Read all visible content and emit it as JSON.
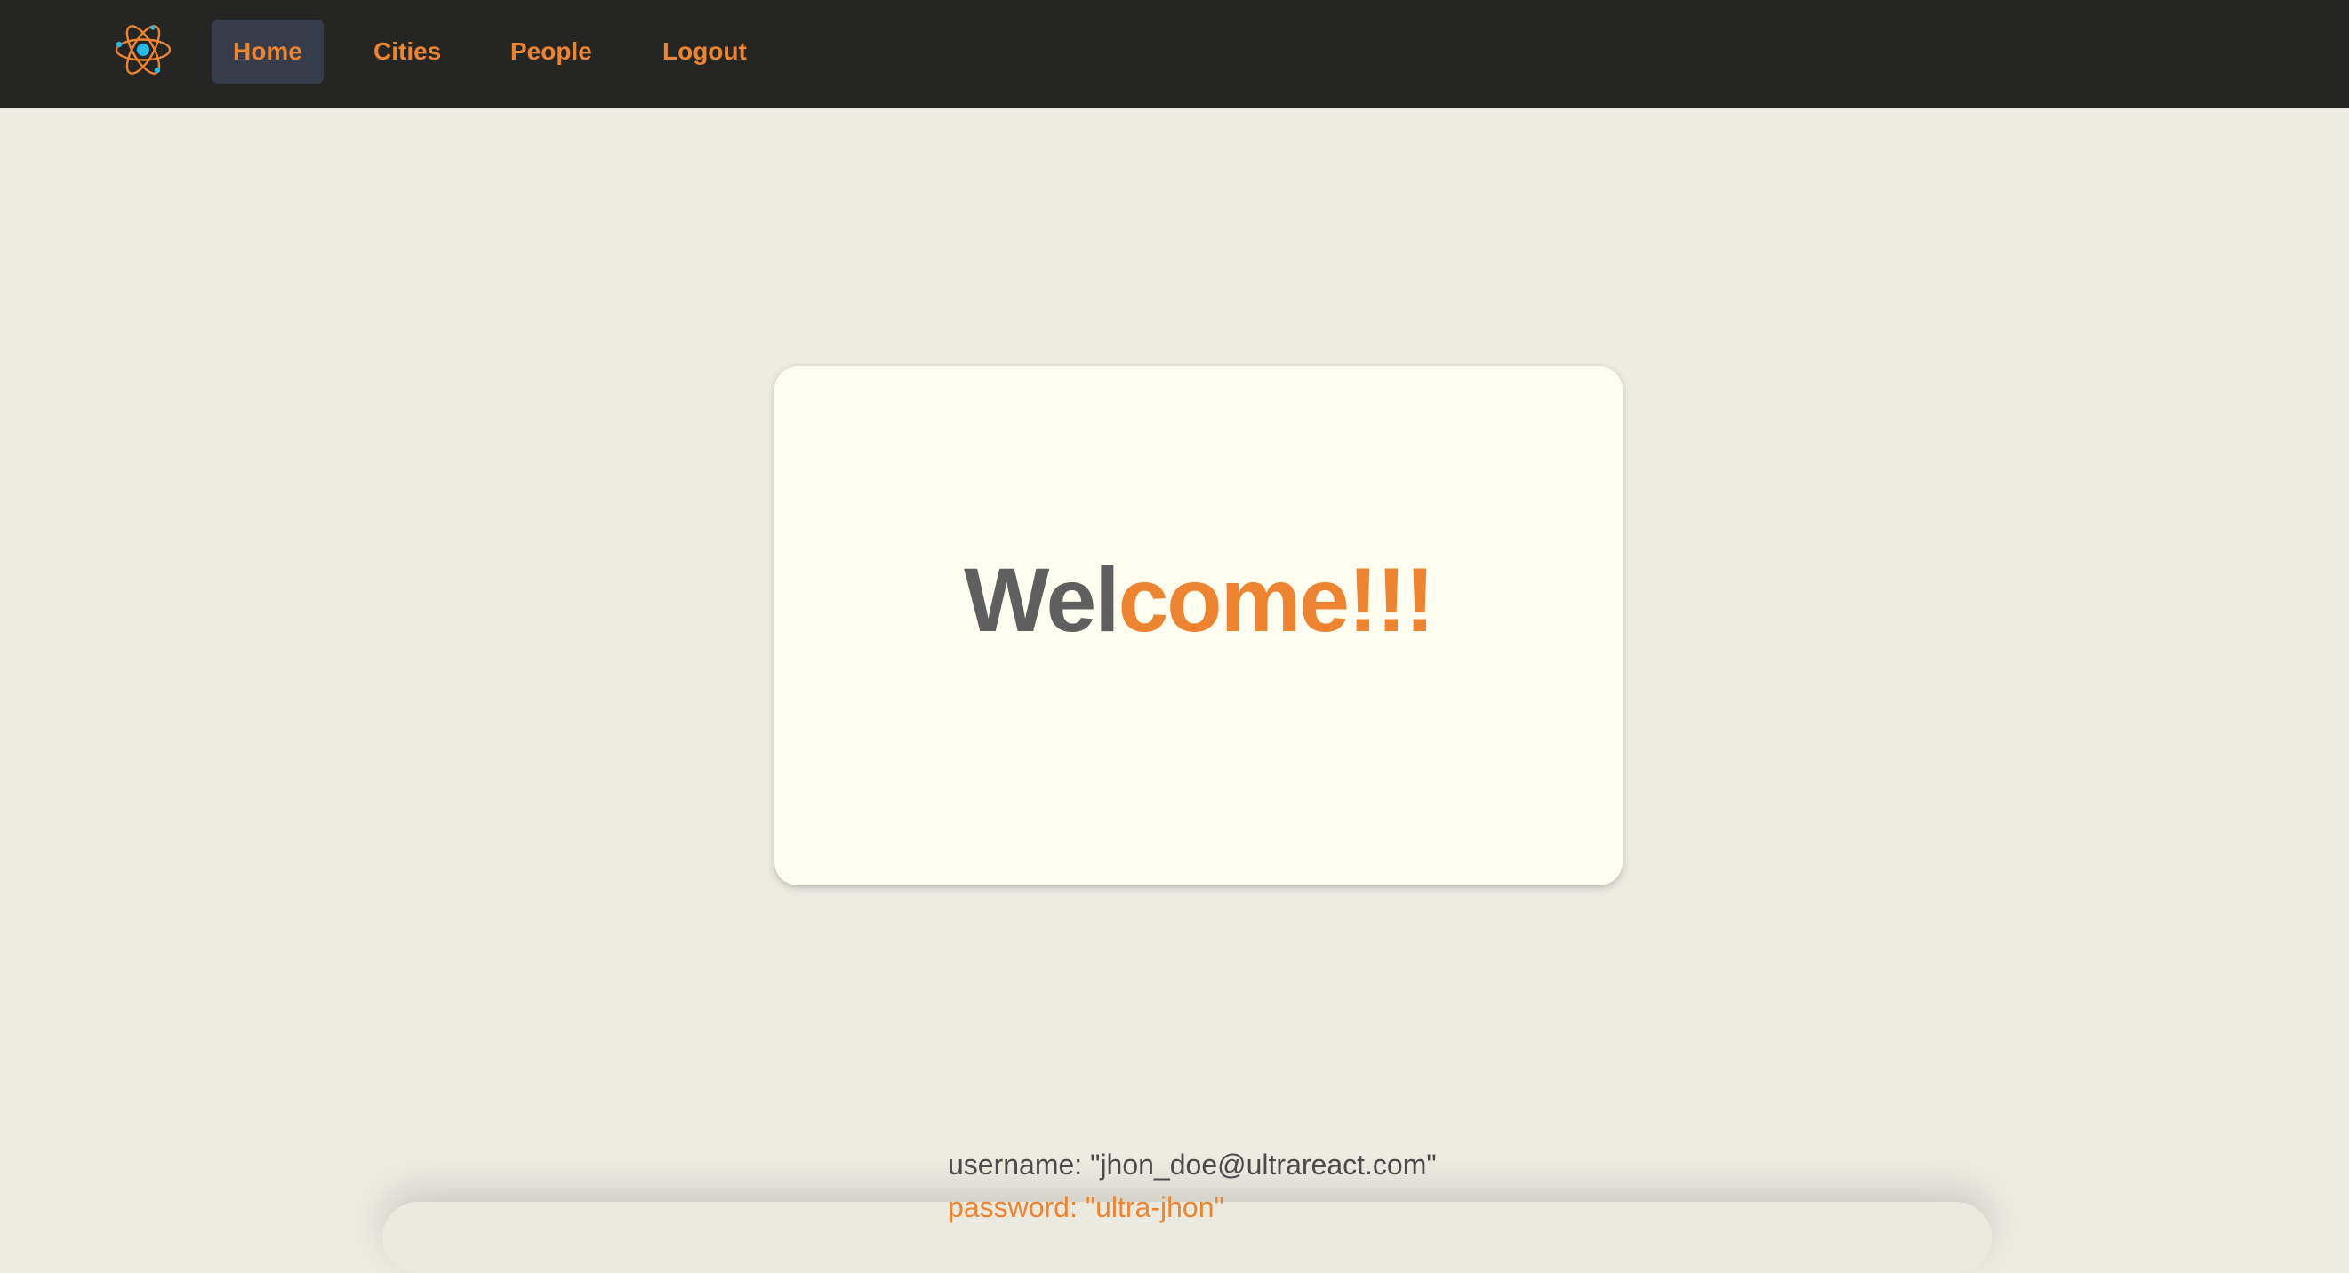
{
  "navbar": {
    "logo_icon": "atom-icon",
    "items": [
      {
        "label": "Home",
        "active": true
      },
      {
        "label": "Cities",
        "active": false
      },
      {
        "label": "People",
        "active": false
      },
      {
        "label": "Logout",
        "active": false
      }
    ]
  },
  "card": {
    "welcome_part1": "Wel",
    "welcome_part2": "come!!!"
  },
  "credentials": {
    "username": "username: \"jhon_doe@ultrareact.com\"",
    "password": "password: \"ultra-jhon\""
  },
  "colors": {
    "navbar_bg": "#252523",
    "accent": "#ec8431",
    "active_bg": "#363c4a",
    "page_bg": "#eeece1",
    "card_bg": "#fffdef",
    "text_gray": "#5f5f5f"
  }
}
